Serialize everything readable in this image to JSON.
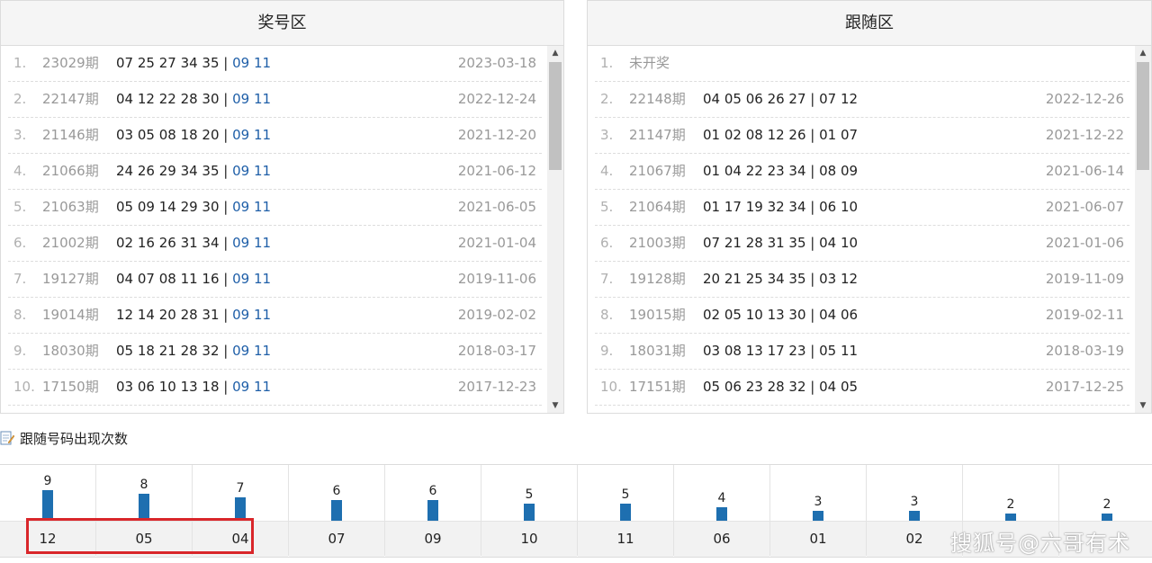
{
  "left_panel": {
    "title": "奖号区",
    "rows": [
      {
        "idx": "1.",
        "issue": "23029期",
        "front": "07 25 27 34 35",
        "sep": " | ",
        "back": "09 11",
        "date": "2023-03-18"
      },
      {
        "idx": "2.",
        "issue": "22147期",
        "front": "04 12 22 28 30",
        "sep": " | ",
        "back": "09 11",
        "date": "2022-12-24"
      },
      {
        "idx": "3.",
        "issue": "21146期",
        "front": "03 05 08 18 20",
        "sep": " | ",
        "back": "09 11",
        "date": "2021-12-20"
      },
      {
        "idx": "4.",
        "issue": "21066期",
        "front": "24 26 29 34 35",
        "sep": " | ",
        "back": "09 11",
        "date": "2021-06-12"
      },
      {
        "idx": "5.",
        "issue": "21063期",
        "front": "05 09 14 29 30",
        "sep": " | ",
        "back": "09 11",
        "date": "2021-06-05"
      },
      {
        "idx": "6.",
        "issue": "21002期",
        "front": "02 16 26 31 34",
        "sep": " | ",
        "back": "09 11",
        "date": "2021-01-04"
      },
      {
        "idx": "7.",
        "issue": "19127期",
        "front": "04 07 08 11 16",
        "sep": " | ",
        "back": "09 11",
        "date": "2019-11-06"
      },
      {
        "idx": "8.",
        "issue": "19014期",
        "front": "12 14 20 28 31",
        "sep": " | ",
        "back": "09 11",
        "date": "2019-02-02"
      },
      {
        "idx": "9.",
        "issue": "18030期",
        "front": "05 18 21 28 32",
        "sep": " | ",
        "back": "09 11",
        "date": "2018-03-17"
      },
      {
        "idx": "10.",
        "issue": "17150期",
        "front": "03 06 10 13 18",
        "sep": " | ",
        "back": "09 11",
        "date": "2017-12-23"
      }
    ]
  },
  "right_panel": {
    "title": "跟随区",
    "rows": [
      {
        "idx": "1.",
        "issue": "未开奖",
        "numbers": "",
        "date": ""
      },
      {
        "idx": "2.",
        "issue": "22148期",
        "numbers": "04 05 06 26 27 | 07 12",
        "date": "2022-12-26"
      },
      {
        "idx": "3.",
        "issue": "21147期",
        "numbers": "01 02 08 12 26 | 01 07",
        "date": "2021-12-22"
      },
      {
        "idx": "4.",
        "issue": "21067期",
        "numbers": "01 04 22 23 34 | 08 09",
        "date": "2021-06-14"
      },
      {
        "idx": "5.",
        "issue": "21064期",
        "numbers": "01 17 19 32 34 | 06 10",
        "date": "2021-06-07"
      },
      {
        "idx": "6.",
        "issue": "21003期",
        "numbers": "07 21 28 31 35 | 04 10",
        "date": "2021-01-06"
      },
      {
        "idx": "7.",
        "issue": "19128期",
        "numbers": "20 21 25 34 35 | 03 12",
        "date": "2019-11-09"
      },
      {
        "idx": "8.",
        "issue": "19015期",
        "numbers": "02 05 10 13 30 | 04 06",
        "date": "2019-02-11"
      },
      {
        "idx": "9.",
        "issue": "18031期",
        "numbers": "03 08 13 17 23 | 05 11",
        "date": "2018-03-19"
      },
      {
        "idx": "10.",
        "issue": "17151期",
        "numbers": "05 06 23 28 32 | 04 05",
        "date": "2017-12-25"
      }
    ]
  },
  "section": {
    "title": "跟随号码出现次数",
    "icon": "document-edit-icon"
  },
  "chart_data": {
    "type": "bar",
    "categories": [
      "12",
      "05",
      "04",
      "07",
      "09",
      "10",
      "11",
      "06",
      "01",
      "02",
      "",
      ""
    ],
    "values": [
      9,
      8,
      7,
      6,
      6,
      5,
      5,
      4,
      3,
      3,
      2,
      2
    ],
    "ylim": [
      0,
      9
    ],
    "bar_color": "#1e6fb0",
    "highlighted_categories": [
      "12",
      "05",
      "04"
    ],
    "highlight_color": "#d9262a"
  },
  "watermark": "搜狐号@六哥有术",
  "colors": {
    "blue_number": "#1f5fa8",
    "bar": "#1e6fb0",
    "highlight": "#d9262a"
  }
}
